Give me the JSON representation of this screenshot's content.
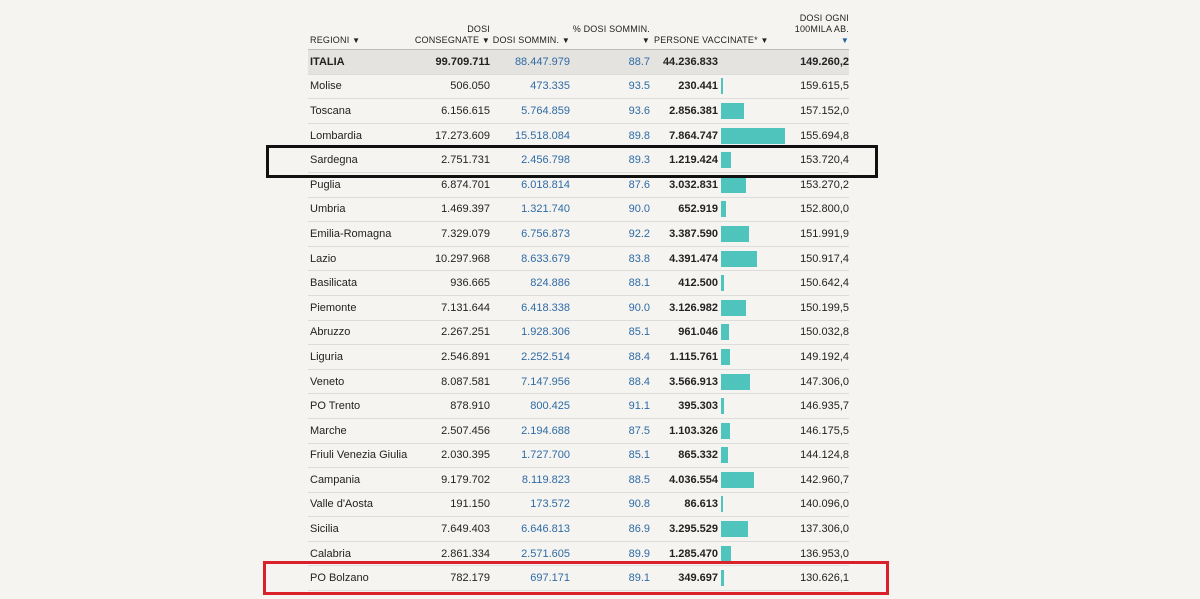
{
  "columns": {
    "regioni": "REGIONI",
    "consegnate": "DOSI CONSEGNATE",
    "somministrate": "DOSI SOMMIN.",
    "percent": "% DOSI SOMMIN.",
    "persone": "PERSONE VACCINATE*",
    "per100k": "DOSI OGNI 100MILA AB.",
    "sort_arrow": "▼"
  },
  "totals": {
    "name": "ITALIA",
    "consegnate": "99.709.711",
    "somministrate": "88.447.979",
    "percent": "88.7",
    "persone": "44.236.833",
    "per100k": "149.260,2"
  },
  "rows": [
    {
      "name": "Molise",
      "consegnate": "506.050",
      "somministrate": "473.335",
      "percent": "93.5",
      "persone": "230.441",
      "per100k": "159.615,5",
      "bar_value": 230441
    },
    {
      "name": "Toscana",
      "consegnate": "6.156.615",
      "somministrate": "5.764.859",
      "percent": "93.6",
      "persone": "2.856.381",
      "per100k": "157.152,0",
      "bar_value": 2856381
    },
    {
      "name": "Lombardia",
      "consegnate": "17.273.609",
      "somministrate": "15.518.084",
      "percent": "89.8",
      "persone": "7.864.747",
      "per100k": "155.694,8",
      "bar_value": 7864747
    },
    {
      "name": "Sardegna",
      "consegnate": "2.751.731",
      "somministrate": "2.456.798",
      "percent": "89.3",
      "persone": "1.219.424",
      "per100k": "153.720,4",
      "bar_value": 1219424
    },
    {
      "name": "Puglia",
      "consegnate": "6.874.701",
      "somministrate": "6.018.814",
      "percent": "87.6",
      "persone": "3.032.831",
      "per100k": "153.270,2",
      "bar_value": 3032831
    },
    {
      "name": "Umbria",
      "consegnate": "1.469.397",
      "somministrate": "1.321.740",
      "percent": "90.0",
      "persone": "652.919",
      "per100k": "152.800,0",
      "bar_value": 652919
    },
    {
      "name": "Emilia-Romagna",
      "consegnate": "7.329.079",
      "somministrate": "6.756.873",
      "percent": "92.2",
      "persone": "3.387.590",
      "per100k": "151.991,9",
      "bar_value": 3387590
    },
    {
      "name": "Lazio",
      "consegnate": "10.297.968",
      "somministrate": "8.633.679",
      "percent": "83.8",
      "persone": "4.391.474",
      "per100k": "150.917,4",
      "bar_value": 4391474
    },
    {
      "name": "Basilicata",
      "consegnate": "936.665",
      "somministrate": "824.886",
      "percent": "88.1",
      "persone": "412.500",
      "per100k": "150.642,4",
      "bar_value": 412500
    },
    {
      "name": "Piemonte",
      "consegnate": "7.131.644",
      "somministrate": "6.418.338",
      "percent": "90.0",
      "persone": "3.126.982",
      "per100k": "150.199,5",
      "bar_value": 3126982
    },
    {
      "name": "Abruzzo",
      "consegnate": "2.267.251",
      "somministrate": "1.928.306",
      "percent": "85.1",
      "persone": "961.046",
      "per100k": "150.032,8",
      "bar_value": 961046
    },
    {
      "name": "Liguria",
      "consegnate": "2.546.891",
      "somministrate": "2.252.514",
      "percent": "88.4",
      "persone": "1.115.761",
      "per100k": "149.192,4",
      "bar_value": 1115761
    },
    {
      "name": "Veneto",
      "consegnate": "8.087.581",
      "somministrate": "7.147.956",
      "percent": "88.4",
      "persone": "3.566.913",
      "per100k": "147.306,0",
      "bar_value": 3566913
    },
    {
      "name": "PO Trento",
      "consegnate": "878.910",
      "somministrate": "800.425",
      "percent": "91.1",
      "persone": "395.303",
      "per100k": "146.935,7",
      "bar_value": 395303
    },
    {
      "name": "Marche",
      "consegnate": "2.507.456",
      "somministrate": "2.194.688",
      "percent": "87.5",
      "persone": "1.103.326",
      "per100k": "146.175,5",
      "bar_value": 1103326
    },
    {
      "name": "Friuli Venezia Giulia",
      "consegnate": "2.030.395",
      "somministrate": "1.727.700",
      "percent": "85.1",
      "persone": "865.332",
      "per100k": "144.124,8",
      "bar_value": 865332
    },
    {
      "name": "Campania",
      "consegnate": "9.179.702",
      "somministrate": "8.119.823",
      "percent": "88.5",
      "persone": "4.036.554",
      "per100k": "142.960,7",
      "bar_value": 4036554
    },
    {
      "name": "Valle d'Aosta",
      "consegnate": "191.150",
      "somministrate": "173.572",
      "percent": "90.8",
      "persone": "86.613",
      "per100k": "140.096,0",
      "bar_value": 86613
    },
    {
      "name": "Sicilia",
      "consegnate": "7.649.403",
      "somministrate": "6.646.813",
      "percent": "86.9",
      "persone": "3.295.529",
      "per100k": "137.306,0",
      "bar_value": 3295529
    },
    {
      "name": "Calabria",
      "consegnate": "2.861.334",
      "somministrate": "2.571.605",
      "percent": "89.9",
      "persone": "1.285.470",
      "per100k": "136.953,0",
      "bar_value": 1285470
    },
    {
      "name": "PO Bolzano",
      "consegnate": "782.179",
      "somministrate": "697.171",
      "percent": "89.1",
      "persone": "349.697",
      "per100k": "130.626,1",
      "bar_value": 349697
    }
  ],
  "bar_max": 7864747,
  "highlights": {
    "black_row": "Sardegna",
    "red_row": "PO Bolzano",
    "black_color": "#111111",
    "red_color": "#d9202b"
  },
  "colors": {
    "bar": "#4fc4bc",
    "blue_text": "#2e6ba5",
    "sort_arrow_active": "#1f5fa8"
  }
}
